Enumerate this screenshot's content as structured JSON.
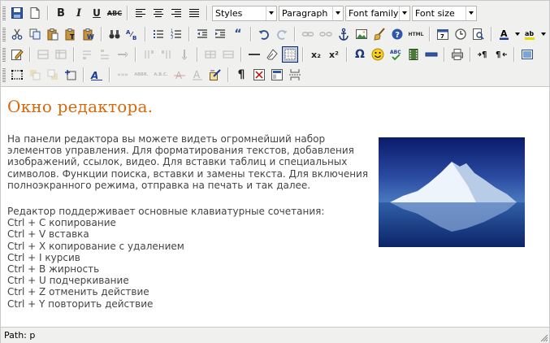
{
  "toolbar": {
    "styles_select": "Styles",
    "format_select": "Paragraph",
    "fontfamily_select": "Font family",
    "fontsize_select": "Font size",
    "bold_label": "B",
    "italic_label": "I",
    "underline_label": "U",
    "strike_label": "ABC",
    "code_label": "HTML",
    "sub_label": "x₂",
    "sup_label": "x²",
    "charmap_label": "Ω",
    "cite_label": "«»»",
    "abbr_label": "ABBR.",
    "acronym_label": "A.B.C.",
    "pilcrow_label": "¶"
  },
  "content": {
    "heading": "Окно редактора.",
    "paragraph1": "На панели редактора вы можете видеть огромнейший набор элементов управления. Для форматирования текстов, добавления изображений, ссылок, видео. Для вставки таблиц и специальных символов. Функции поиска, вставки и замены текста. Для включения полноэкранного режима, отправка на печать и так далее.",
    "shortcuts_intro": "Редактор поддерживает основные клавиатурные сочетания:",
    "shortcuts": [
      "Ctrl + C копирование",
      "Ctrl + V вставка",
      "Ctrl + X копирование с удалением",
      "Ctrl + I курсив",
      "Ctrl + B жирность",
      "Ctrl + U подчеркивание",
      "Ctrl + Z отменить действие",
      "Ctrl + Y повторить действие"
    ]
  },
  "status": {
    "path": "Path: p"
  },
  "colors": {
    "heading": "#d9680b",
    "body_text": "#444444",
    "toolbar_bg": "#f0f0ee",
    "border": "#c9c9c9"
  }
}
